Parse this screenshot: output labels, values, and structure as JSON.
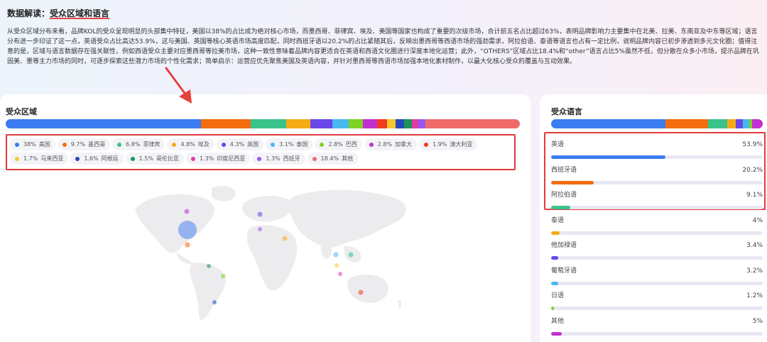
{
  "header": {
    "title_prefix": "数据解读：",
    "title_highlight": "受众区域和语言",
    "paragraph": "从受众区域分布来看，品牌KOL的受众呈现明显的头部集中特征，美国以38%的占比成为绝对核心市场，而墨西哥、菲律宾、埃及、美国等国家也构成了重要的次级市场，合计前五名占比超过63%，表明品牌影响力主要集中在北美、拉美、东南亚及中东等区域；语言分布进一步印证了这一点，英语受众占比高达53.9%，这与美国、英国等核心英语市场高度匹配，同时西班牙语以20.2%的占比紧随其后，反映出墨西哥等西语市场的强劲需求，阿拉伯语、泰语等语言也占有一定比例，说明品牌内容已初步渗透到多元文化圈；值得注意的是，区域与语言数据存在强关联性，例如西语受众主要对应墨西哥等拉美市场，这种一致性意味着品牌内容更适合在英语和西语文化圈进行深度本地化运营；此外，“OTHERS”区域占比18.4%和“other”语言占比5%虽然不低，但分散在众多小市场，提示品牌在巩固美、墨等主力市场的同时，可逐步探索这些潜力市场的个性化需求；简单启示：运营应优先聚焦美国及英语内容，并针对墨西哥等西语市场加强本地化素材制作，以最大化核心受众的覆盖与互动效果。"
  },
  "region_card": {
    "title": "受众区域",
    "segments": [
      {
        "value": 38,
        "color": "#3d7bf0"
      },
      {
        "value": 9.7,
        "color": "#f36d10"
      },
      {
        "value": 6.8,
        "color": "#39c38a"
      },
      {
        "value": 4.8,
        "color": "#f5ab16"
      },
      {
        "value": 4.3,
        "color": "#6a45e8"
      },
      {
        "value": 3.1,
        "color": "#48b8f0"
      },
      {
        "value": 2.8,
        "color": "#7fd122"
      },
      {
        "value": 2.8,
        "color": "#c22fd0"
      },
      {
        "value": 1.9,
        "color": "#f23a1d"
      },
      {
        "value": 1.7,
        "color": "#f7c730"
      },
      {
        "value": 1.6,
        "color": "#2549b8"
      },
      {
        "value": 1.5,
        "color": "#1e9357"
      },
      {
        "value": 1.3,
        "color": "#e33aa6"
      },
      {
        "value": 1.3,
        "color": "#9a55f0"
      },
      {
        "value": 18.4,
        "color": "#f06a6a"
      }
    ],
    "legend": [
      {
        "pct": "38%",
        "name": "美国",
        "color": "#3d7bf0"
      },
      {
        "pct": "9.7%",
        "name": "墨西哥",
        "color": "#f36d10"
      },
      {
        "pct": "6.8%",
        "name": "菲律宾",
        "color": "#39c38a"
      },
      {
        "pct": "4.8%",
        "name": "埃及",
        "color": "#f5ab16"
      },
      {
        "pct": "4.3%",
        "name": "英国",
        "color": "#6a45e8"
      },
      {
        "pct": "3.1%",
        "name": "泰国",
        "color": "#48b8f0"
      },
      {
        "pct": "2.8%",
        "name": "巴西",
        "color": "#7fd122"
      },
      {
        "pct": "2.8%",
        "name": "加拿大",
        "color": "#c22fd0"
      },
      {
        "pct": "1.9%",
        "name": "澳大利亚",
        "color": "#f23a1d"
      },
      {
        "pct": "1.7%",
        "name": "马来西亚",
        "color": "#f7c730"
      },
      {
        "pct": "1.6%",
        "name": "阿根廷",
        "color": "#2549b8"
      },
      {
        "pct": "1.5%",
        "name": "哥伦比亚",
        "color": "#1e9357"
      },
      {
        "pct": "1.3%",
        "name": "印度尼西亚",
        "color": "#e33aa6"
      },
      {
        "pct": "1.3%",
        "name": "西班牙",
        "color": "#9a55f0"
      },
      {
        "pct": "18.4%",
        "name": "其他",
        "color": "#f06a6a"
      }
    ]
  },
  "language_card": {
    "title": "受众语言",
    "segments": [
      {
        "value": 53.9,
        "color": "#3d7bf0"
      },
      {
        "value": 20.2,
        "color": "#f36d10"
      },
      {
        "value": 9.1,
        "color": "#39c38a"
      },
      {
        "value": 4,
        "color": "#f5ab16"
      },
      {
        "value": 3.4,
        "color": "#6a45e8"
      },
      {
        "value": 3.2,
        "color": "#48b8f0"
      },
      {
        "value": 1.2,
        "color": "#7fd122"
      },
      {
        "value": 5,
        "color": "#c22fd0"
      }
    ],
    "items": [
      {
        "name": "英语",
        "pct_label": "53.9%",
        "value": 53.9,
        "color": "#3d7bf0"
      },
      {
        "name": "西班牙语",
        "pct_label": "20.2%",
        "value": 20.2,
        "color": "#f36d10"
      },
      {
        "name": "阿拉伯语",
        "pct_label": "9.1%",
        "value": 9.1,
        "color": "#39c38a"
      },
      {
        "name": "泰语",
        "pct_label": "4%",
        "value": 4,
        "color": "#f5ab16"
      },
      {
        "name": "他加禄语",
        "pct_label": "3.4%",
        "value": 3.4,
        "color": "#6a45e8"
      },
      {
        "name": "葡萄牙语",
        "pct_label": "3.2%",
        "value": 3.2,
        "color": "#48b8f0"
      },
      {
        "name": "日语",
        "pct_label": "1.2%",
        "value": 1.2,
        "color": "#7fd122"
      },
      {
        "name": "其他",
        "pct_label": "5%",
        "value": 5,
        "color": "#c22fd0"
      }
    ]
  },
  "annotation": {
    "arrow_color": "#e8403f",
    "box_color": "#e03b3b"
  }
}
